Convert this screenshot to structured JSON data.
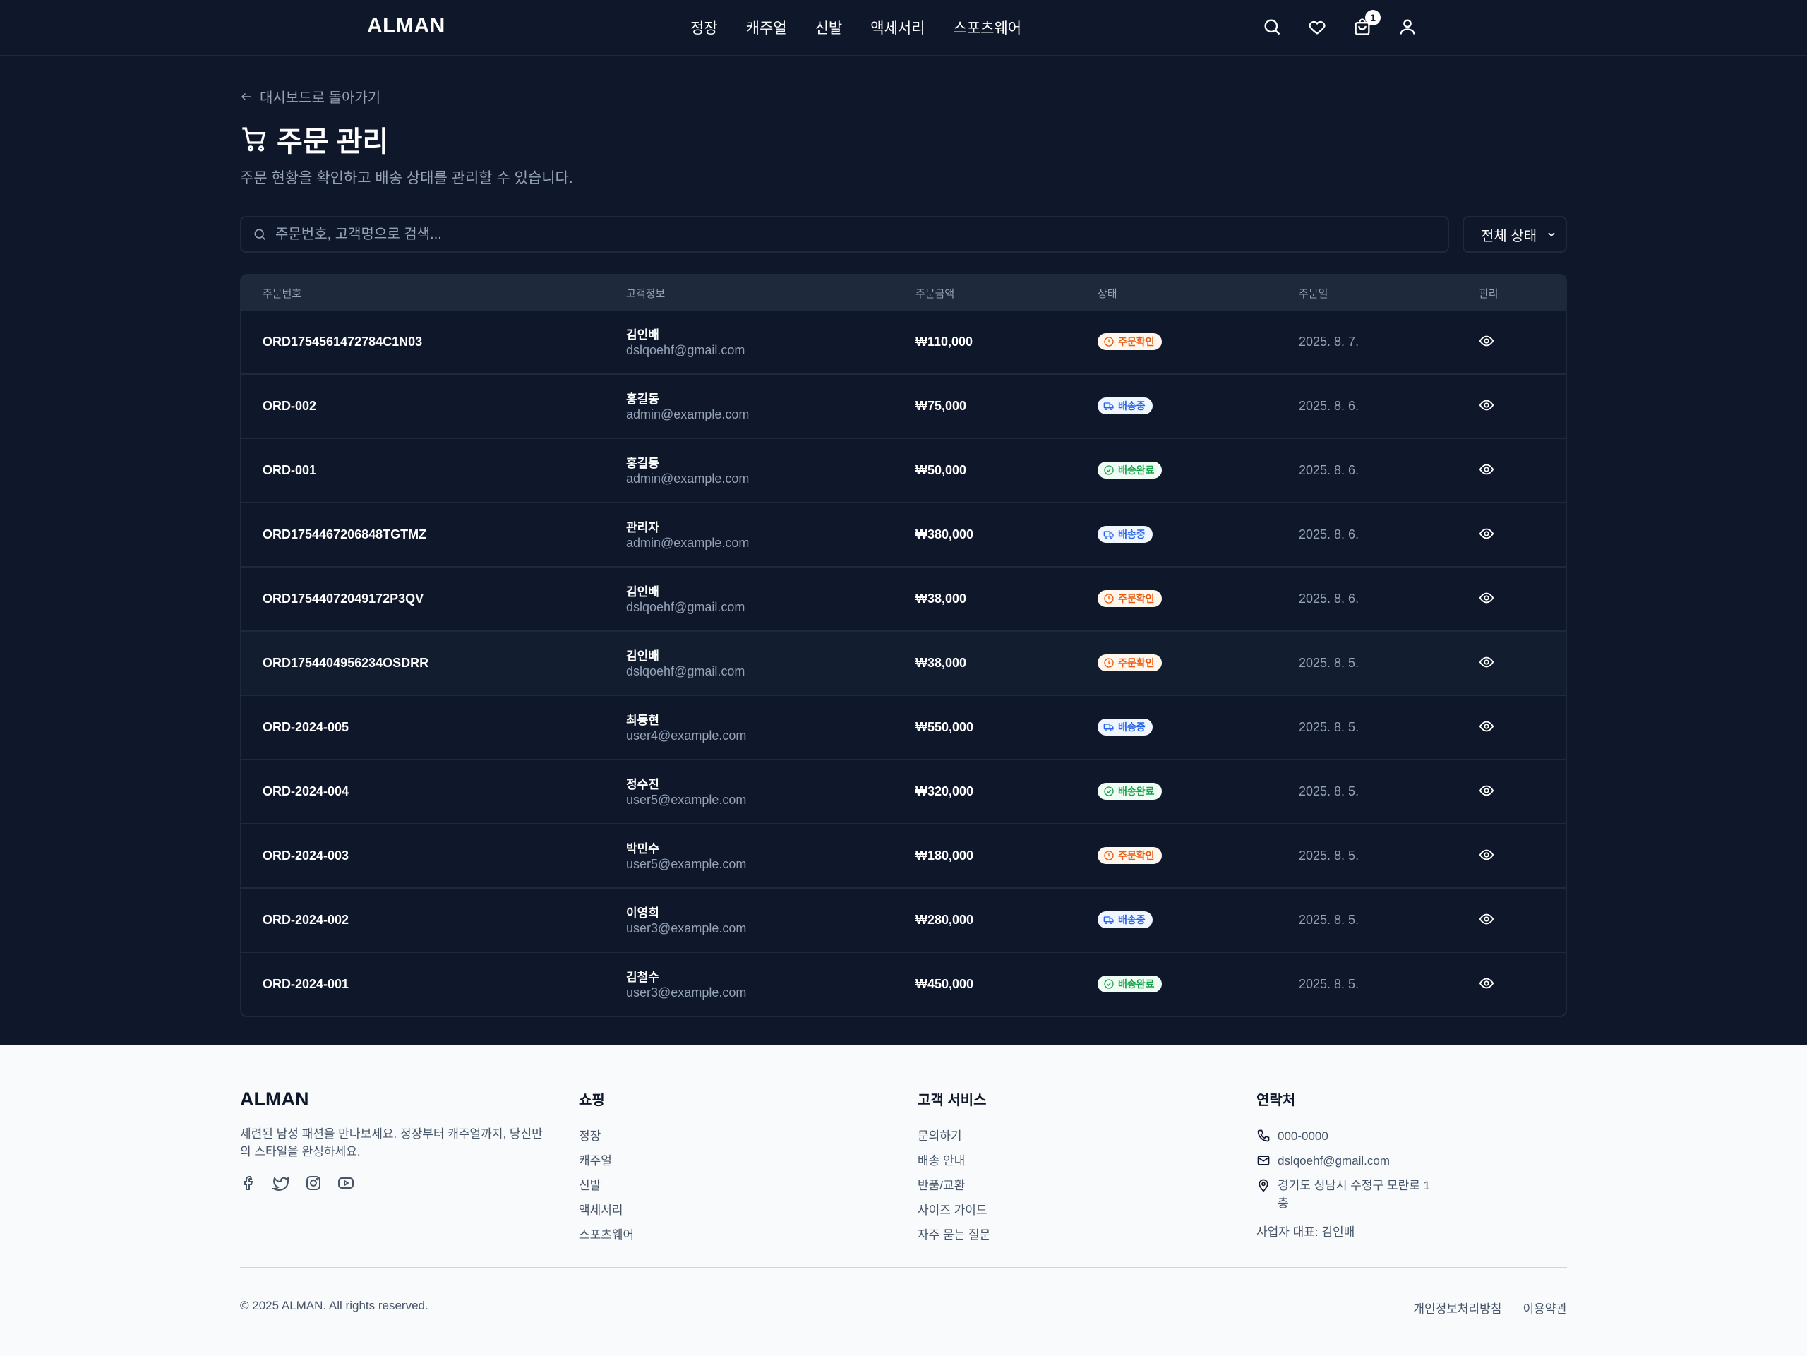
{
  "header": {
    "logo": "ALMAN",
    "nav": [
      "정장",
      "캐주얼",
      "신발",
      "액세서리",
      "스포츠웨어"
    ],
    "cart_count": "1"
  },
  "page": {
    "back_link": "대시보드로 돌아가기",
    "title": "주문 관리",
    "subtitle": "주문 현황을 확인하고 배송 상태를 관리할 수 있습니다.",
    "search_placeholder": "주문번호, 고객명으로 검색...",
    "status_filter": "전체 상태"
  },
  "table": {
    "headers": [
      "주문번호",
      "고객정보",
      "주문금액",
      "상태",
      "주문일",
      "관리"
    ],
    "rows": [
      {
        "id": "ORD1754561472784C1N03",
        "name": "김인배",
        "email": "dslqoehf@gmail.com",
        "amount": "₩110,000",
        "status": "주문확인",
        "status_type": "confirm",
        "date": "2025. 8. 7."
      },
      {
        "id": "ORD-002",
        "name": "홍길동",
        "email": "admin@example.com",
        "amount": "₩75,000",
        "status": "배송중",
        "status_type": "ship",
        "date": "2025. 8. 6."
      },
      {
        "id": "ORD-001",
        "name": "홍길동",
        "email": "admin@example.com",
        "amount": "₩50,000",
        "status": "배송완료",
        "status_type": "done",
        "date": "2025. 8. 6."
      },
      {
        "id": "ORD1754467206848TGTMZ",
        "name": "관리자",
        "email": "admin@example.com",
        "amount": "₩380,000",
        "status": "배송중",
        "status_type": "ship",
        "date": "2025. 8. 6."
      },
      {
        "id": "ORD17544072049172P3QV",
        "name": "김인배",
        "email": "dslqoehf@gmail.com",
        "amount": "₩38,000",
        "status": "주문확인",
        "status_type": "confirm",
        "date": "2025. 8. 6."
      },
      {
        "id": "ORD1754404956234OSDRR",
        "name": "김인배",
        "email": "dslqoehf@gmail.com",
        "amount": "₩38,000",
        "status": "주문확인",
        "status_type": "confirm",
        "date": "2025. 8. 5."
      },
      {
        "id": "ORD-2024-005",
        "name": "최동현",
        "email": "user4@example.com",
        "amount": "₩550,000",
        "status": "배송중",
        "status_type": "ship",
        "date": "2025. 8. 5."
      },
      {
        "id": "ORD-2024-004",
        "name": "정수진",
        "email": "user5@example.com",
        "amount": "₩320,000",
        "status": "배송완료",
        "status_type": "done",
        "date": "2025. 8. 5."
      },
      {
        "id": "ORD-2024-003",
        "name": "박민수",
        "email": "user5@example.com",
        "amount": "₩180,000",
        "status": "주문확인",
        "status_type": "confirm",
        "date": "2025. 8. 5."
      },
      {
        "id": "ORD-2024-002",
        "name": "이영희",
        "email": "user3@example.com",
        "amount": "₩280,000",
        "status": "배송중",
        "status_type": "ship",
        "date": "2025. 8. 5."
      },
      {
        "id": "ORD-2024-001",
        "name": "김철수",
        "email": "user3@example.com",
        "amount": "₩450,000",
        "status": "배송완료",
        "status_type": "done",
        "date": "2025. 8. 5."
      }
    ]
  },
  "footer": {
    "brand": "ALMAN",
    "description": "세련된 남성 패션을 만나보세요. 정장부터 캐주얼까지, 당신만의 스타일을 완성하세요.",
    "shopping": {
      "title": "쇼핑",
      "links": [
        "정장",
        "캐주얼",
        "신발",
        "액세서리",
        "스포츠웨어"
      ]
    },
    "service": {
      "title": "고객 서비스",
      "links": [
        "문의하기",
        "배송 안내",
        "반품/교환",
        "사이즈 가이드",
        "자주 묻는 질문"
      ]
    },
    "contact": {
      "title": "연락처",
      "phone": "000-0000",
      "email": "dslqoehf@gmail.com",
      "address": "경기도 성남시 수정구 모란로 1층",
      "representative": "사업자 대표: 김인배"
    },
    "copyright": "© 2025 ALMAN. All rights reserved.",
    "legal_links": [
      "개인정보처리방침",
      "이용약관"
    ]
  }
}
